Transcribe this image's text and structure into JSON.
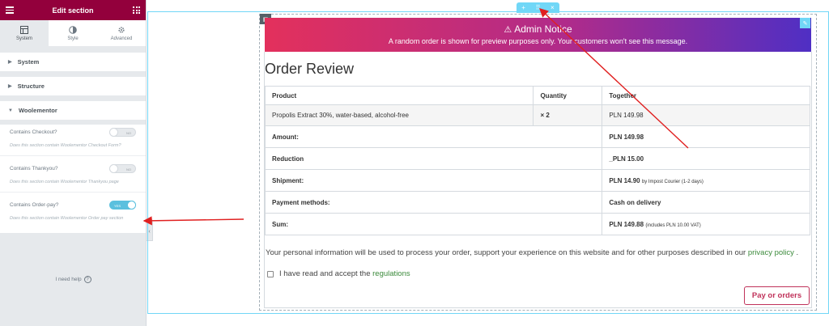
{
  "panel": {
    "title": "Edit section",
    "tabs": [
      {
        "label": "System",
        "icon": "layout-icon"
      },
      {
        "label": "Style",
        "icon": "half-circle-icon"
      },
      {
        "label": "Advanced",
        "icon": "gear-icon"
      }
    ],
    "sections": {
      "system": "System",
      "structure": "Structure",
      "woolementor": "Woolementor"
    },
    "controls": [
      {
        "label": "Contains Checkout?",
        "toggle_text": "NO",
        "on": false,
        "desc": "Does this section contain Woolementor Checkout Form?"
      },
      {
        "label": "Contains Thankyou?",
        "toggle_text": "NO",
        "on": false,
        "desc": "Does this section contain Woolementor Thankyou page"
      },
      {
        "label": "Contains Order-pay?",
        "toggle_text": "YES",
        "on": true,
        "desc": "Does this section contain Woolementor Order pay section"
      }
    ],
    "help": "I need help",
    "colors": {
      "brand": "#93003c",
      "toggle_on": "#5bc0de"
    }
  },
  "canvas": {
    "notice": {
      "title": "Admin Notice",
      "message": "A random order is shown for preview purposes only. Your customers won't see this message."
    },
    "order_title": "Order Review",
    "table": {
      "headers": [
        "Product",
        "Quantity",
        "Together"
      ],
      "product": {
        "name": "Propolis Extract 30%, water-based, alcohol-free",
        "qty": "× 2",
        "price": "PLN 149.98"
      },
      "rows": [
        {
          "label": "Amount:",
          "value": "PLN 149.98",
          "note": ""
        },
        {
          "label": "Reduction",
          "value": "_PLN 15.00",
          "note": ""
        },
        {
          "label": "Shipment:",
          "value": "PLN 14.90",
          "note": "by Impost Courier (1-2 days)"
        },
        {
          "label": "Payment methods:",
          "value": "Cash on delivery",
          "note": ""
        },
        {
          "label": "Sum:",
          "value": "PLN 149.88",
          "note": "(includes PLN 10.00 VAT)"
        }
      ]
    },
    "privacy_text": "Your personal information will be used to process your order, support your experience on this website and for other purposes described in our",
    "privacy_link": "privacy policy",
    "privacy_end": ".",
    "accept_text": "I have read and accept the",
    "accept_link": "regulations",
    "pay_button": "Pay or orders",
    "colors": {
      "notice_start": "#e3305c",
      "notice_end": "#4f2fc4",
      "link": "#3b8a3b",
      "button": "#c0325a",
      "editor_outline": "#71d7f7"
    }
  }
}
